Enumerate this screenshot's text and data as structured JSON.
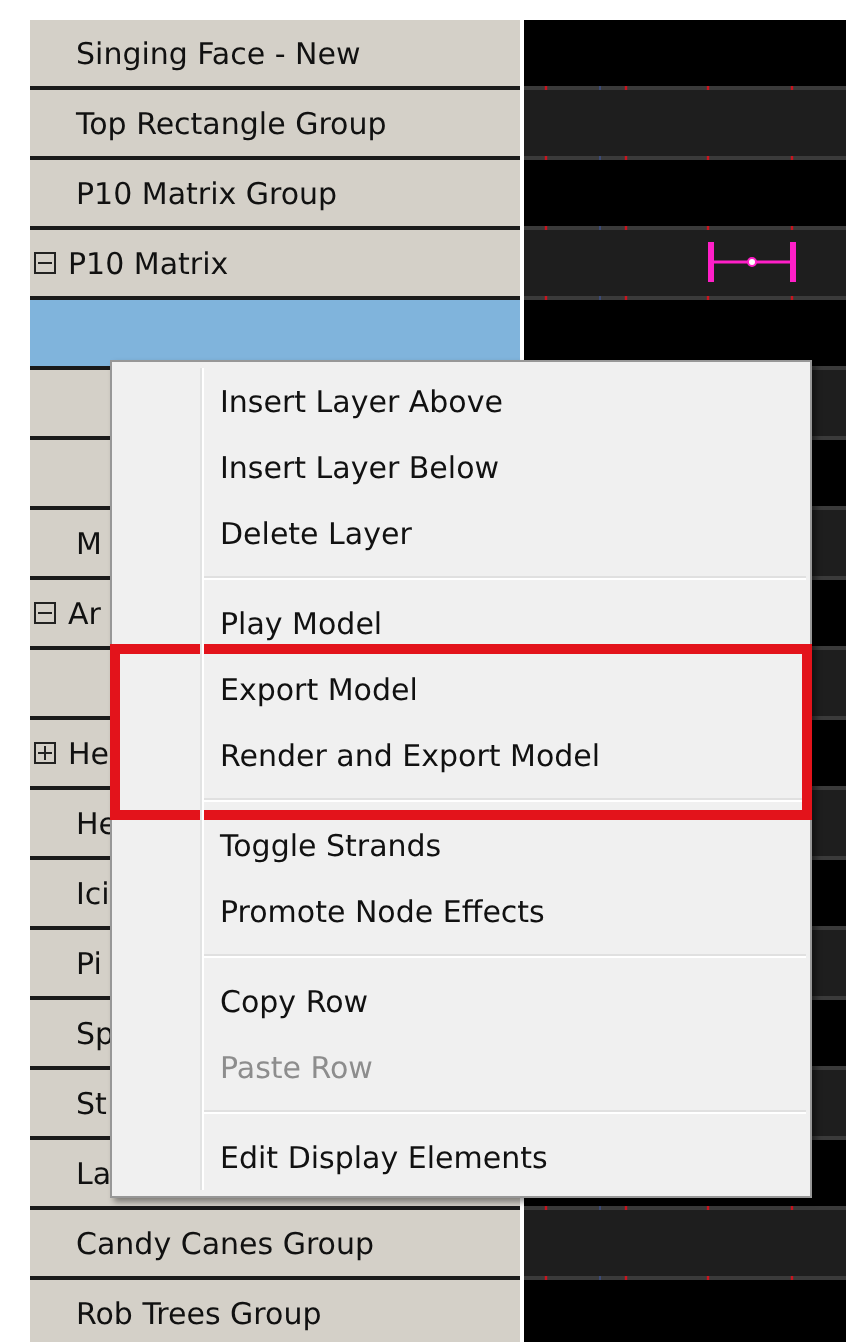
{
  "layers": [
    {
      "label": "Singing Face - New",
      "selected": false,
      "effect": false
    },
    {
      "label": "Top Rectangle Group",
      "selected": false,
      "effect": false
    },
    {
      "label": "P10 Matrix Group",
      "selected": false,
      "effect": false
    },
    {
      "label": "P10 Matrix",
      "expanded": true,
      "selected": false,
      "effect": true
    },
    {
      "selected": true,
      "effect": false
    },
    {
      "selected": false,
      "effect": false
    },
    {
      "selected": false,
      "effect": false
    },
    {
      "label": "M",
      "selected": false,
      "effect": false
    },
    {
      "label": "Ar",
      "expanded": true,
      "selected": false,
      "effect": false
    },
    {
      "selected": false,
      "effect": false
    },
    {
      "label": "He",
      "expanded": false,
      "selected": false,
      "effect": false
    },
    {
      "label": "He",
      "selected": false,
      "effect": false
    },
    {
      "label": "Ici",
      "selected": false,
      "effect": false
    },
    {
      "label": "Pi",
      "selected": false,
      "effect": false
    },
    {
      "label": "Sp",
      "selected": false,
      "effect": false
    },
    {
      "label": "St",
      "selected": false,
      "effect": false
    },
    {
      "label": "La",
      "selected": false,
      "effect": false
    },
    {
      "label": "Candy Canes Group",
      "selected": false,
      "effect": false
    },
    {
      "label": "Rob Trees Group",
      "selected": false,
      "effect": false
    }
  ],
  "context_menu": [
    {
      "kind": "item",
      "label": "Insert Layer Above",
      "disabled": false,
      "highlighted": false
    },
    {
      "kind": "item",
      "label": "Insert Layer Below",
      "disabled": false,
      "highlighted": false
    },
    {
      "kind": "item",
      "label": "Delete Layer",
      "disabled": false,
      "highlighted": false
    },
    {
      "kind": "separator"
    },
    {
      "kind": "item",
      "label": "Play Model",
      "disabled": false,
      "highlighted": false
    },
    {
      "kind": "item",
      "label": "Export Model",
      "disabled": false,
      "highlighted": true
    },
    {
      "kind": "item",
      "label": "Render and Export Model",
      "disabled": false,
      "highlighted": true
    },
    {
      "kind": "separator"
    },
    {
      "kind": "item",
      "label": "Toggle Strands",
      "disabled": false,
      "highlighted": false
    },
    {
      "kind": "item",
      "label": "Promote Node Effects",
      "disabled": false,
      "highlighted": false
    },
    {
      "kind": "separator"
    },
    {
      "kind": "item",
      "label": "Copy Row",
      "disabled": false,
      "highlighted": false
    },
    {
      "kind": "item",
      "label": "Paste Row",
      "disabled": true,
      "highlighted": false
    },
    {
      "kind": "separator"
    },
    {
      "kind": "item",
      "label": "Edit Display Elements",
      "disabled": false,
      "highlighted": false
    }
  ]
}
